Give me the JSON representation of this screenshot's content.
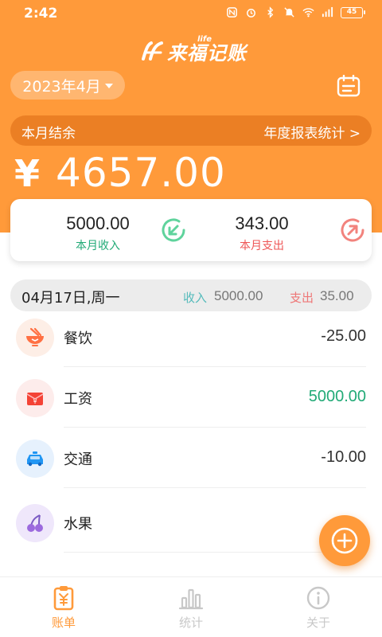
{
  "status_bar": {
    "time": "2:42",
    "battery": "45"
  },
  "app": {
    "logo_text": "来福记账",
    "logo_sup": "life"
  },
  "header": {
    "month": "2023年4月"
  },
  "balance": {
    "label": "本月结余",
    "report_link": "年度报表统计 >",
    "currency": "¥",
    "amount": "4657.00"
  },
  "summary": {
    "income_value": "5000.00",
    "income_label": "本月收入",
    "expense_value": "343.00",
    "expense_label": "本月支出"
  },
  "day_group": {
    "date": "04月17日,周一",
    "income_label": "收入",
    "income_value": "5000.00",
    "expense_label": "支出",
    "expense_value": "35.00"
  },
  "transactions": [
    {
      "name": "餐饮",
      "amount": "-25.00",
      "icon": "food-bowl-icon",
      "color": "#ff7043"
    },
    {
      "name": "工资",
      "amount": "5000.00",
      "icon": "salary-envelope-icon",
      "color": "#f44336"
    },
    {
      "name": "交通",
      "amount": "-10.00",
      "icon": "taxi-icon",
      "color": "#2196f3"
    },
    {
      "name": "水果",
      "amount": "",
      "icon": "cherry-icon",
      "color": "#9c6ade"
    }
  ],
  "nav": {
    "bill": "账单",
    "stats": "统计",
    "about": "关于"
  },
  "colors": {
    "accent": "#ff9a3a",
    "income": "#22aa77",
    "expense": "#ee5555"
  }
}
